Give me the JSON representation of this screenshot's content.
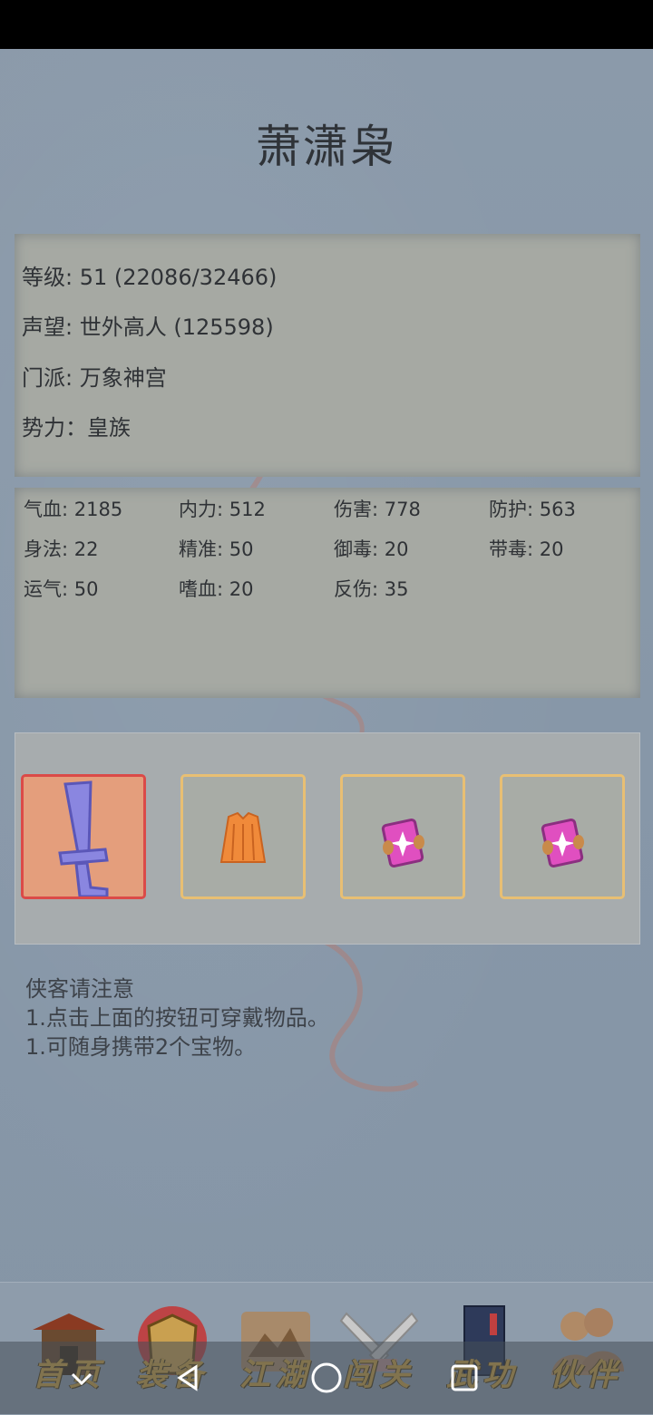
{
  "character": {
    "name": "萧潇枭"
  },
  "info": {
    "level": "等级: 51 (22086/32466)",
    "prestige": "声望: 世外高人 (125598)",
    "sect": "门派: 万象神宫",
    "faction": "势力：皇族"
  },
  "stats": [
    {
      "text": "气血: 2185"
    },
    {
      "text": "内力: 512"
    },
    {
      "text": "伤害: 778"
    },
    {
      "text": "防护: 563"
    },
    {
      "text": "身法: 22"
    },
    {
      "text": "精准: 50"
    },
    {
      "text": "御毒: 20"
    },
    {
      "text": "带毒: 20"
    },
    {
      "text": "运气: 50"
    },
    {
      "text": "嗜血: 20"
    },
    {
      "text": "反伤: 35"
    }
  ],
  "equipment": [
    {
      "icon": "sword-icon",
      "rarity_color": "#db4a48"
    },
    {
      "icon": "robe-icon",
      "rarity_color": "#e8bf73"
    },
    {
      "icon": "treasure-box-icon",
      "rarity_color": "#e8bf73"
    },
    {
      "icon": "treasure-box-icon",
      "rarity_color": "#e8bf73"
    }
  ],
  "notice": {
    "heading": "侠客请注意",
    "line1": "1.点击上面的按钮可穿戴物品。",
    "line2": "1.可随身携带2个宝物。"
  },
  "nav": [
    {
      "label": "首页",
      "icon": "temple-icon"
    },
    {
      "label": "装备",
      "icon": "armor-icon"
    },
    {
      "label": "江湖",
      "icon": "scroll-map-icon"
    },
    {
      "label": "闯关",
      "icon": "crossed-swords-icon"
    },
    {
      "label": "武功",
      "icon": "book-icon"
    },
    {
      "label": "伙伴",
      "icon": "companions-icon"
    }
  ],
  "colors": {
    "background": "#8797a8",
    "panel": "#a6a9a3",
    "nav_label": "#caa043",
    "weapon_border": "#db4a48",
    "item_border": "#e8bf73"
  }
}
